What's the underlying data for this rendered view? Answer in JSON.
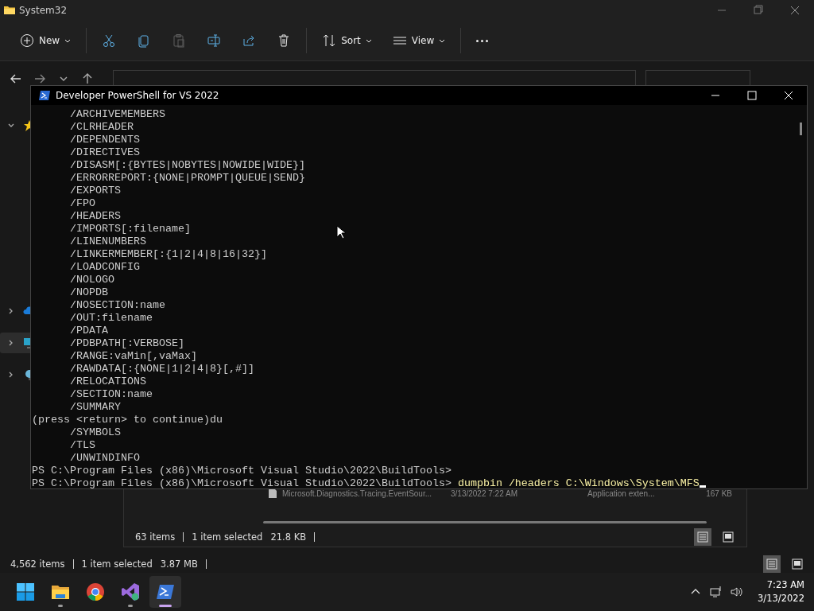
{
  "explorer": {
    "title": "System32",
    "toolbar": [
      {
        "kind": "new",
        "label": "New",
        "disabled": false
      },
      {
        "kind": "cut",
        "disabled": false
      },
      {
        "kind": "copy",
        "disabled": false
      },
      {
        "kind": "paste",
        "disabled": true
      },
      {
        "kind": "rename",
        "disabled": false
      },
      {
        "kind": "share",
        "disabled": false
      },
      {
        "kind": "delete",
        "disabled": false
      },
      {
        "kind": "sort",
        "label": "Sort",
        "disabled": false
      },
      {
        "kind": "view",
        "label": "View",
        "disabled": false
      },
      {
        "kind": "more",
        "disabled": false
      }
    ],
    "sidebar": {
      "items": [
        {
          "kind": "quick-access",
          "expanded": true,
          "selected": false
        },
        {
          "kind": "cloud",
          "expanded": false,
          "selected": false
        },
        {
          "kind": "pc",
          "expanded": false,
          "selected": true
        },
        {
          "kind": "network",
          "expanded": false,
          "selected": false
        }
      ]
    },
    "status_bar": {
      "items": "4,562 items",
      "selection": "1 item selected",
      "size": "3.87 MB",
      "views": [
        {
          "kind": "details",
          "selected": true
        },
        {
          "kind": "tiles",
          "selected": false
        }
      ]
    }
  },
  "second_explorer": {
    "file_row": {
      "name": "Microsoft.Diagnostics.Tracing.EventSour...",
      "modified": "3/13/2022 7:22 AM",
      "type": "Application exten...",
      "size": "167 KB"
    },
    "status_bar": {
      "items": "63 items",
      "selection": "1 item selected",
      "size": "21.8 KB",
      "views": [
        {
          "kind": "details",
          "selected": true
        },
        {
          "kind": "tiles",
          "selected": false
        }
      ]
    }
  },
  "console": {
    "title": "Developer PowerShell for VS 2022",
    "lines": [
      "      /ARCHIVEMEMBERS",
      "      /CLRHEADER",
      "      /DEPENDENTS",
      "      /DIRECTIVES",
      "      /DISASM[:{BYTES|NOBYTES|NOWIDE|WIDE}]",
      "      /ERRORREPORT:{NONE|PROMPT|QUEUE|SEND}",
      "      /EXPORTS",
      "      /FPO",
      "      /HEADERS",
      "      /IMPORTS[:filename]",
      "      /LINENUMBERS",
      "      /LINKERMEMBER[:{1|2|4|8|16|32}]",
      "      /LOADCONFIG",
      "      /NOLOGO",
      "      /NOPDB",
      "      /NOSECTION:name",
      "      /OUT:filename",
      "      /PDATA",
      "      /PDBPATH[:VERBOSE]",
      "      /RANGE:vaMin[,vaMax]",
      "      /RAWDATA[:{NONE|1|2|4|8}[,#]]",
      "      /RELOCATIONS",
      "      /SECTION:name",
      "      /SUMMARY",
      "(press <return> to continue)du",
      "      /SYMBOLS",
      "      /TLS",
      "      /UNWINDINFO",
      "PS C:\\Program Files (x86)\\Microsoft Visual Studio\\2022\\BuildTools>"
    ],
    "prompt": "PS C:\\Program Files (x86)\\Microsoft Visual Studio\\2022\\BuildTools>",
    "command": "dumpbin /headers C:\\Windows\\System\\MFS"
  },
  "taskbar": {
    "apps": [
      {
        "kind": "start",
        "running": false,
        "active": false
      },
      {
        "kind": "folder",
        "running": true,
        "active": false
      },
      {
        "kind": "chrome",
        "running": false,
        "active": false
      },
      {
        "kind": "vs",
        "running": true,
        "active": false
      },
      {
        "kind": "powershell",
        "running": true,
        "active": true
      }
    ],
    "time": "7:23 AM",
    "date": "3/13/2022"
  }
}
